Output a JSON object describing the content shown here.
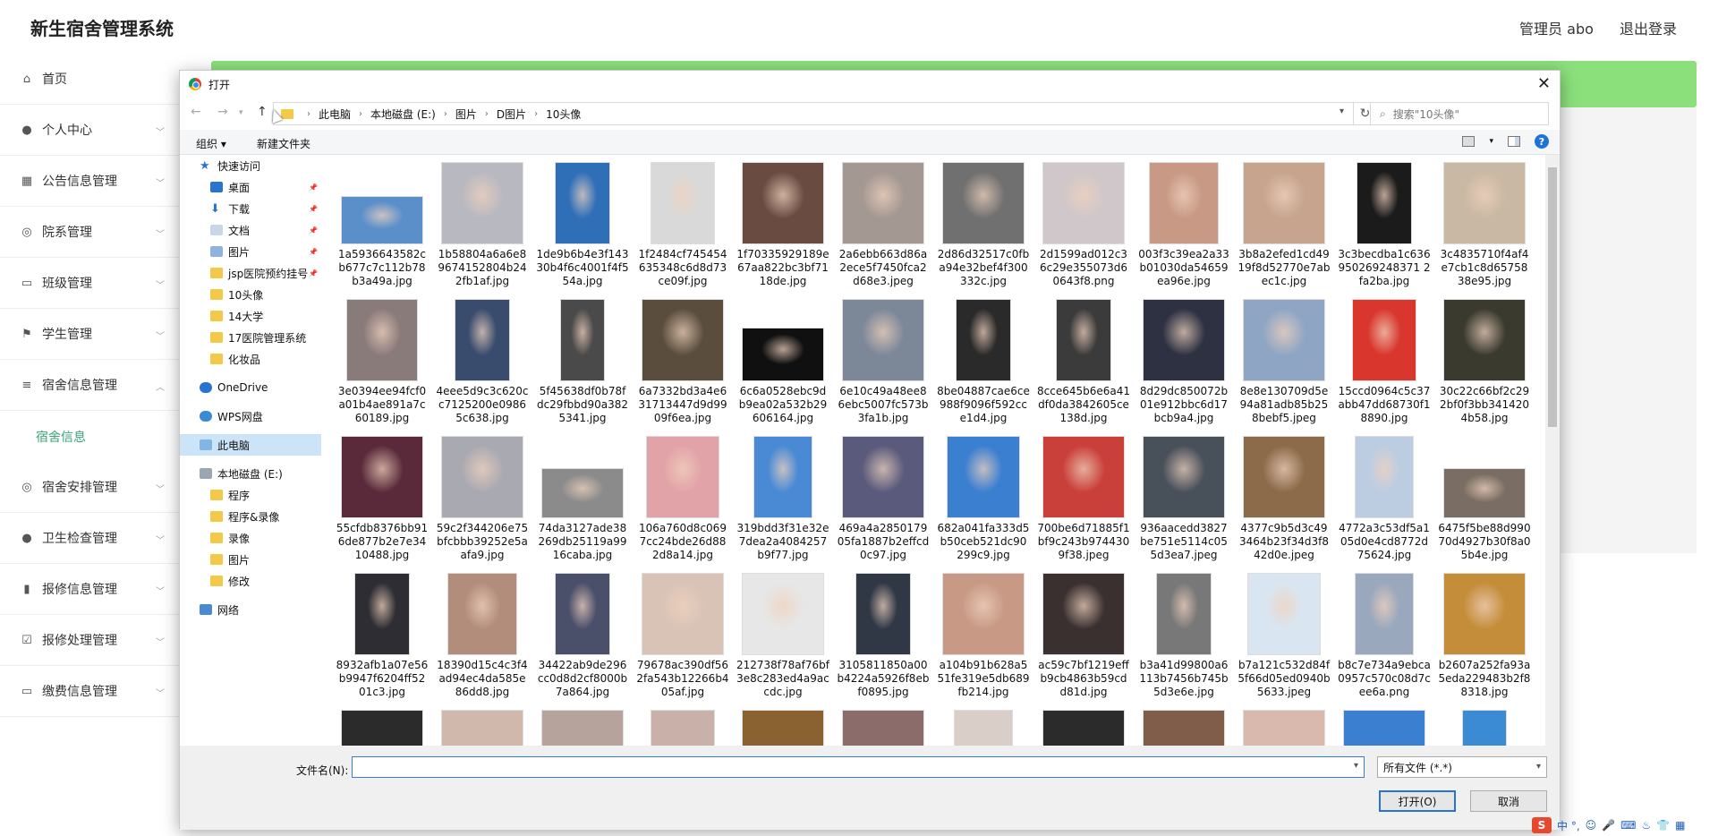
{
  "app": {
    "title": "新生宿舍管理系统",
    "user": "管理员 abo",
    "logout": "退出登录"
  },
  "sidebar": {
    "items": [
      {
        "label": "首页",
        "icon": "home-icon"
      },
      {
        "label": "个人中心",
        "icon": "user-icon",
        "chevron": true
      },
      {
        "label": "公告信息管理",
        "icon": "grid-icon",
        "chevron": true
      },
      {
        "label": "院系管理",
        "icon": "compass-icon",
        "chevron": true
      },
      {
        "label": "班级管理",
        "icon": "chat-icon",
        "chevron": true
      },
      {
        "label": "学生管理",
        "icon": "flag-icon",
        "chevron": true
      },
      {
        "label": "宿舍信息管理",
        "icon": "list-icon",
        "chevron": true,
        "expanded": true
      },
      {
        "label": "宿舍安排管理",
        "icon": "compass-icon",
        "chevron": true
      },
      {
        "label": "卫生检查管理",
        "icon": "user-icon",
        "chevron": true
      },
      {
        "label": "报修信息管理",
        "icon": "bar-chart-icon",
        "chevron": true
      },
      {
        "label": "报修处理管理",
        "icon": "checklist-icon",
        "chevron": true
      },
      {
        "label": "缴费信息管理",
        "icon": "chat-icon",
        "chevron": true
      }
    ],
    "submenu": {
      "label": "宿舍信息"
    }
  },
  "dialog": {
    "title": "打开",
    "breadcrumbs": [
      "此电脑",
      "本地磁盘 (E:)",
      "图片",
      "D图片",
      "10头像"
    ],
    "search_placeholder": "搜索\"10头像\"",
    "toolbar": {
      "organize": "组织 ▾",
      "new_folder": "新建文件夹"
    },
    "nav": [
      {
        "label": "快速访问",
        "type": "star",
        "indent": 0
      },
      {
        "label": "桌面",
        "type": "desktop",
        "indent": 1,
        "pin": true
      },
      {
        "label": "下载",
        "type": "download",
        "indent": 1,
        "pin": true
      },
      {
        "label": "文档",
        "type": "doc",
        "indent": 1,
        "pin": true
      },
      {
        "label": "图片",
        "type": "pic",
        "indent": 1,
        "pin": true
      },
      {
        "label": "jsp医院预约挂号",
        "type": "folder",
        "indent": 1,
        "pin": true
      },
      {
        "label": "10头像",
        "type": "folder",
        "indent": 1
      },
      {
        "label": "14大学",
        "type": "folder",
        "indent": 1
      },
      {
        "label": "17医院管理系统",
        "type": "folder",
        "indent": 1
      },
      {
        "label": "化妆品",
        "type": "folder",
        "indent": 1
      },
      {
        "label": "OneDrive",
        "type": "cloud",
        "indent": 0,
        "gap": true
      },
      {
        "label": "WPS网盘",
        "type": "cloud2",
        "indent": 0,
        "gap": true
      },
      {
        "label": "此电脑",
        "type": "pc",
        "indent": 0,
        "gap": true,
        "selected": true
      },
      {
        "label": "本地磁盘 (E:)",
        "type": "drive",
        "indent": 0,
        "gap": true
      },
      {
        "label": "程序",
        "type": "folder",
        "indent": 1
      },
      {
        "label": "程序&录像",
        "type": "folder",
        "indent": 1
      },
      {
        "label": "录像",
        "type": "folder",
        "indent": 1
      },
      {
        "label": "图片",
        "type": "folder",
        "indent": 1
      },
      {
        "label": "修改",
        "type": "folder",
        "indent": 1
      },
      {
        "label": "网络",
        "type": "net",
        "indent": 0,
        "gap": true
      }
    ],
    "files": [
      {
        "name": "1a5936643582cb677c7c112b78b3a49a.jpg",
        "w": 92,
        "h": 54,
        "c": "#5b8fc9"
      },
      {
        "name": "1b58804a6a6e89674152804b242fb1af.jpg",
        "w": 92,
        "h": 92,
        "c": "#b8b8c0"
      },
      {
        "name": "1de9b6b4e3f14330b4f6c4001f4f554a.jpg",
        "w": 62,
        "h": 92,
        "c": "#2f6fb8"
      },
      {
        "name": "1f2484cf745454635348c6d8d73ce09f.jpg",
        "w": 72,
        "h": 92,
        "c": "#d9d9d9"
      },
      {
        "name": "1f70335929189e67aa822bc3bf7118de.jpg",
        "w": 92,
        "h": 92,
        "c": "#6a4b42"
      },
      {
        "name": "2a6ebb663d86a2ece5f7450fca2d68e3.jpeg",
        "w": 92,
        "h": 92,
        "c": "#a49892"
      },
      {
        "name": "2d86d32517c0fba94e32bef4f300332c.jpg",
        "w": 92,
        "h": 92,
        "c": "#707070"
      },
      {
        "name": "2d1599ad012c36c29e355073d60643f8.png",
        "w": 92,
        "h": 92,
        "c": "#cfc7c9"
      },
      {
        "name": "003f3c39ea2a33b01030da54659ea96e.jpg",
        "w": 78,
        "h": 92,
        "c": "#c89a86"
      },
      {
        "name": "3b8a2efed1cd4919f8d52770e7abec1c.jpg",
        "w": 92,
        "h": 92,
        "c": "#c6a48e"
      },
      {
        "name": "3c3becdba1c636950269248371 2fa2ba.jpg",
        "w": 62,
        "h": 92,
        "c": "#1b1b1b"
      },
      {
        "name": "3c4835710f4af4e7cb1c8d6575838e95.jpg",
        "w": 92,
        "h": 92,
        "c": "#c9b8a3"
      },
      {
        "name": "3e0394ee94fcf0a01b4ae891a7c60189.jpg",
        "w": 80,
        "h": 92,
        "c": "#8a7b7b"
      },
      {
        "name": "4eee5d9c3c620cc7125200e09865c638.jpg",
        "w": 62,
        "h": 92,
        "c": "#3a4c6d"
      },
      {
        "name": "5f45638df0b78fdc29fbbd90a3825341.jpg",
        "w": 50,
        "h": 92,
        "c": "#4a4a4a"
      },
      {
        "name": "6a7332bd3a4e631713447d9d9909f6ea.jpg",
        "w": 92,
        "h": 92,
        "c": "#5a4d3d"
      },
      {
        "name": "6c6a0528ebc9db9ea02a532b29606164.jpg",
        "w": 92,
        "h": 60,
        "c": "#101010"
      },
      {
        "name": "6e10c49a48ee86ebc5007fc573b3fa1b.jpg",
        "w": 92,
        "h": 92,
        "c": "#7c8798"
      },
      {
        "name": "8be04887cae6ce988f9096f592cce1d4.jpg",
        "w": 62,
        "h": 92,
        "c": "#2a2a2a"
      },
      {
        "name": "8cce645b6e6a41df0da3842605ce138d.jpg",
        "w": 62,
        "h": 92,
        "c": "#3b3b3b"
      },
      {
        "name": "8d29dc850072b01e912bbc6d17bcb9a4.jpg",
        "w": 92,
        "h": 92,
        "c": "#2d3142"
      },
      {
        "name": "8e8e130709d5e94a81adb85b258bebf5.jpeg",
        "w": 92,
        "h": 92,
        "c": "#8ea6c4"
      },
      {
        "name": "15ccd0964c5c37abb47dd68730f18890.jpg",
        "w": 72,
        "h": 92,
        "c": "#d9362e"
      },
      {
        "name": "30c22c66bf2c292bf0f3bb3414204b58.jpg",
        "w": 92,
        "h": 92,
        "c": "#3a3a2f"
      },
      {
        "name": "55cfdb8376bb916de877b2e7e3410488.jpg",
        "w": 92,
        "h": 92,
        "c": "#5a2a3a"
      },
      {
        "name": "59c2f344206e75bfcbbb39252e5aafa9.jpg",
        "w": 92,
        "h": 92,
        "c": "#a9a9b2"
      },
      {
        "name": "74da3127ade38269db25119a9916caba.jpg",
        "w": 92,
        "h": 56,
        "c": "#8b8b8b"
      },
      {
        "name": "106a760d8c0697cc24bde26d882d8a14.jpg",
        "w": 82,
        "h": 92,
        "c": "#e2a3a8"
      },
      {
        "name": "319bdd3f31e32e7dea2a4084257b9f77.jpg",
        "w": 66,
        "h": 92,
        "c": "#4a8ad4"
      },
      {
        "name": "469a4a285017905fa1887b2effcd0c97.jpg",
        "w": 92,
        "h": 92,
        "c": "#5a5a7c"
      },
      {
        "name": "682a041fa333d5b50ceb521dc90299c9.jpg",
        "w": 82,
        "h": 92,
        "c": "#3a7fd0"
      },
      {
        "name": "700be6d71885f1bf9c243b9744309f38.jpeg",
        "w": 92,
        "h": 92,
        "c": "#c9403a"
      },
      {
        "name": "936aacedd3827be751e5114c055d3ea7.jpeg",
        "w": 92,
        "h": 92,
        "c": "#48505a"
      },
      {
        "name": "4377c9b5d3c493464b23f34d3f842d0e.jpeg",
        "w": 92,
        "h": 92,
        "c": "#8c6b4a"
      },
      {
        "name": "4772a3c53df5a105d0e4cd8772d75624.jpg",
        "w": 66,
        "h": 92,
        "c": "#bccde2"
      },
      {
        "name": "6475f5be88d99070d4927b30f8a05b4e.jpg",
        "w": 92,
        "h": 56,
        "c": "#7a6e64"
      },
      {
        "name": "8932afb1a07e56b9947f6204ff5201c3.jpg",
        "w": 62,
        "h": 92,
        "c": "#2d2d33"
      },
      {
        "name": "18390d15c4c3f4ad94ec4da585e86dd8.jpg",
        "w": 78,
        "h": 92,
        "c": "#b28d7c"
      },
      {
        "name": "34422ab9de296cc0d8d2cf8000b7a864.jpg",
        "w": 62,
        "h": 92,
        "c": "#4a4f6a"
      },
      {
        "name": "79678ac390df562fa543b12266b405af.jpg",
        "w": 92,
        "h": 92,
        "c": "#d9c3b7"
      },
      {
        "name": "212738f78af76bf3e8c283ed4a9accdc.jpg",
        "w": 92,
        "h": 92,
        "c": "#e7e7e7"
      },
      {
        "name": "3105811850a00b4224a5926f8ebf0895.jpg",
        "w": 62,
        "h": 92,
        "c": "#303846"
      },
      {
        "name": "a104b91b628a551fe319e5db689fb214.jpg",
        "w": 92,
        "h": 92,
        "c": "#c89a86"
      },
      {
        "name": "ac59c7bf1219effb9cb4863b59cdd81d.jpg",
        "w": 92,
        "h": 92,
        "c": "#3a3030"
      },
      {
        "name": "b3a41d99800a6113b7456b745b5d3e6e.jpg",
        "w": 62,
        "h": 92,
        "c": "#787878"
      },
      {
        "name": "b7a121c532d84f5f66d05ed0940b5633.jpeg",
        "w": 82,
        "h": 92,
        "c": "#d9e6f2"
      },
      {
        "name": "b8c7e734a9ebca0957c570c08d7cee6a.png",
        "w": 66,
        "h": 92,
        "c": "#9aa8bd"
      },
      {
        "name": "b2607a252fa93a5eda229483b2f88318.jpg",
        "w": 92,
        "h": 92,
        "c": "#c48d3a"
      }
    ],
    "partial_row": [
      {
        "w": 92,
        "c": "#2b2b2b"
      },
      {
        "w": 92,
        "c": "#d1b8ad"
      },
      {
        "w": 92,
        "c": "#b5a39c"
      },
      {
        "w": 72,
        "c": "#c9b0a8"
      },
      {
        "w": 92,
        "c": "#8a6232"
      },
      {
        "w": 92,
        "c": "#8c6b6b"
      },
      {
        "w": 66,
        "c": "#d9cfc8"
      },
      {
        "w": 92,
        "c": "#2b2b2b"
      },
      {
        "w": 92,
        "c": "#7f5d4a"
      },
      {
        "w": 92,
        "c": "#d9b8ad"
      },
      {
        "w": 92,
        "c": "#3a7fd0"
      },
      {
        "w": 50,
        "c": "#3a8ad4"
      }
    ],
    "filename_label": "文件名(N):",
    "filetype": "所有文件 (*.*)",
    "open_button": "打开(O)",
    "cancel_button": "取消"
  },
  "ime": {
    "chars": "中 °,"
  }
}
